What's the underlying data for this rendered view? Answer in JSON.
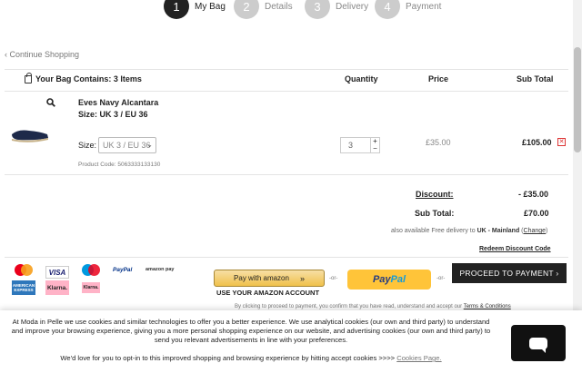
{
  "stepper": [
    {
      "number": "1",
      "label": "My Bag",
      "active": true
    },
    {
      "number": "2",
      "label": "Details",
      "active": false
    },
    {
      "number": "3",
      "label": "Delivery",
      "active": false
    },
    {
      "number": "4",
      "label": "Payment",
      "active": false
    }
  ],
  "continue_link": "‹ Continue Shopping",
  "table_headers": {
    "bag": "Your Bag Contains: 3 Items",
    "quantity": "Quantity",
    "price": "Price",
    "subtotal": "Sub Total"
  },
  "item": {
    "name": "Eves Navy Alcantara",
    "size_text": "Size: UK 3 / EU 36",
    "size_label": "Size:",
    "size_selected": "UK 3 / EU 36",
    "product_code": "Product Code: 5063333133130",
    "quantity": "3",
    "price": "£35.00",
    "subtotal": "£105.00",
    "remove_icon": "close-icon"
  },
  "totals": {
    "discount_label": "Discount:",
    "discount_value": "- £35.00",
    "subtotal_label": "Sub Total:",
    "subtotal_value": "£70.00",
    "delivery_prefix": "also available Free delivery to ",
    "delivery_region": "UK - Mainland",
    "change_link": "Change",
    "redeem_link": "Redeem Discount Code"
  },
  "payment_logos": {
    "visa": "VISA",
    "paypal": "PayPal",
    "amazon_pay": "amazon pay",
    "amex": "AMERICAN EXPRESS",
    "klarna": "Klarna.",
    "klarna_small": "Klarna."
  },
  "checkout": {
    "amazon_button": "Pay with amazon",
    "amazon_sub": "USE YOUR AMAZON ACCOUNT",
    "or": "-or-",
    "paypal_pay": "Pay",
    "paypal_pal": "Pal",
    "proceed": "PROCEED TO PAYMENT ›",
    "terms_prefix": "By clicking to proceed to payment, you confirm that you have read, understand and accept our ",
    "terms_link": "Terms & Conditions"
  },
  "cookie_banner": {
    "text": "At Moda in Pelle we use cookies and similar technologies to offer you a better experience. We use analytical cookies (our own and third party) to understand and improve your browsing experience, giving you a more personal shopping experience on our website, and advertising cookies (our own and third party) to send you relevant advertisements in line with your preferences.",
    "opt_in": "We'd love for you to opt-in to this improved shopping and browsing experience by hitting accept cookies >>>> ",
    "link": "Cookies Page."
  },
  "colors": {
    "step_active": "#222222",
    "step_inactive": "#cccccc",
    "paypal_yellow": "#ffc439",
    "proceed_bg": "#222222",
    "remove_red": "#dd3333"
  }
}
